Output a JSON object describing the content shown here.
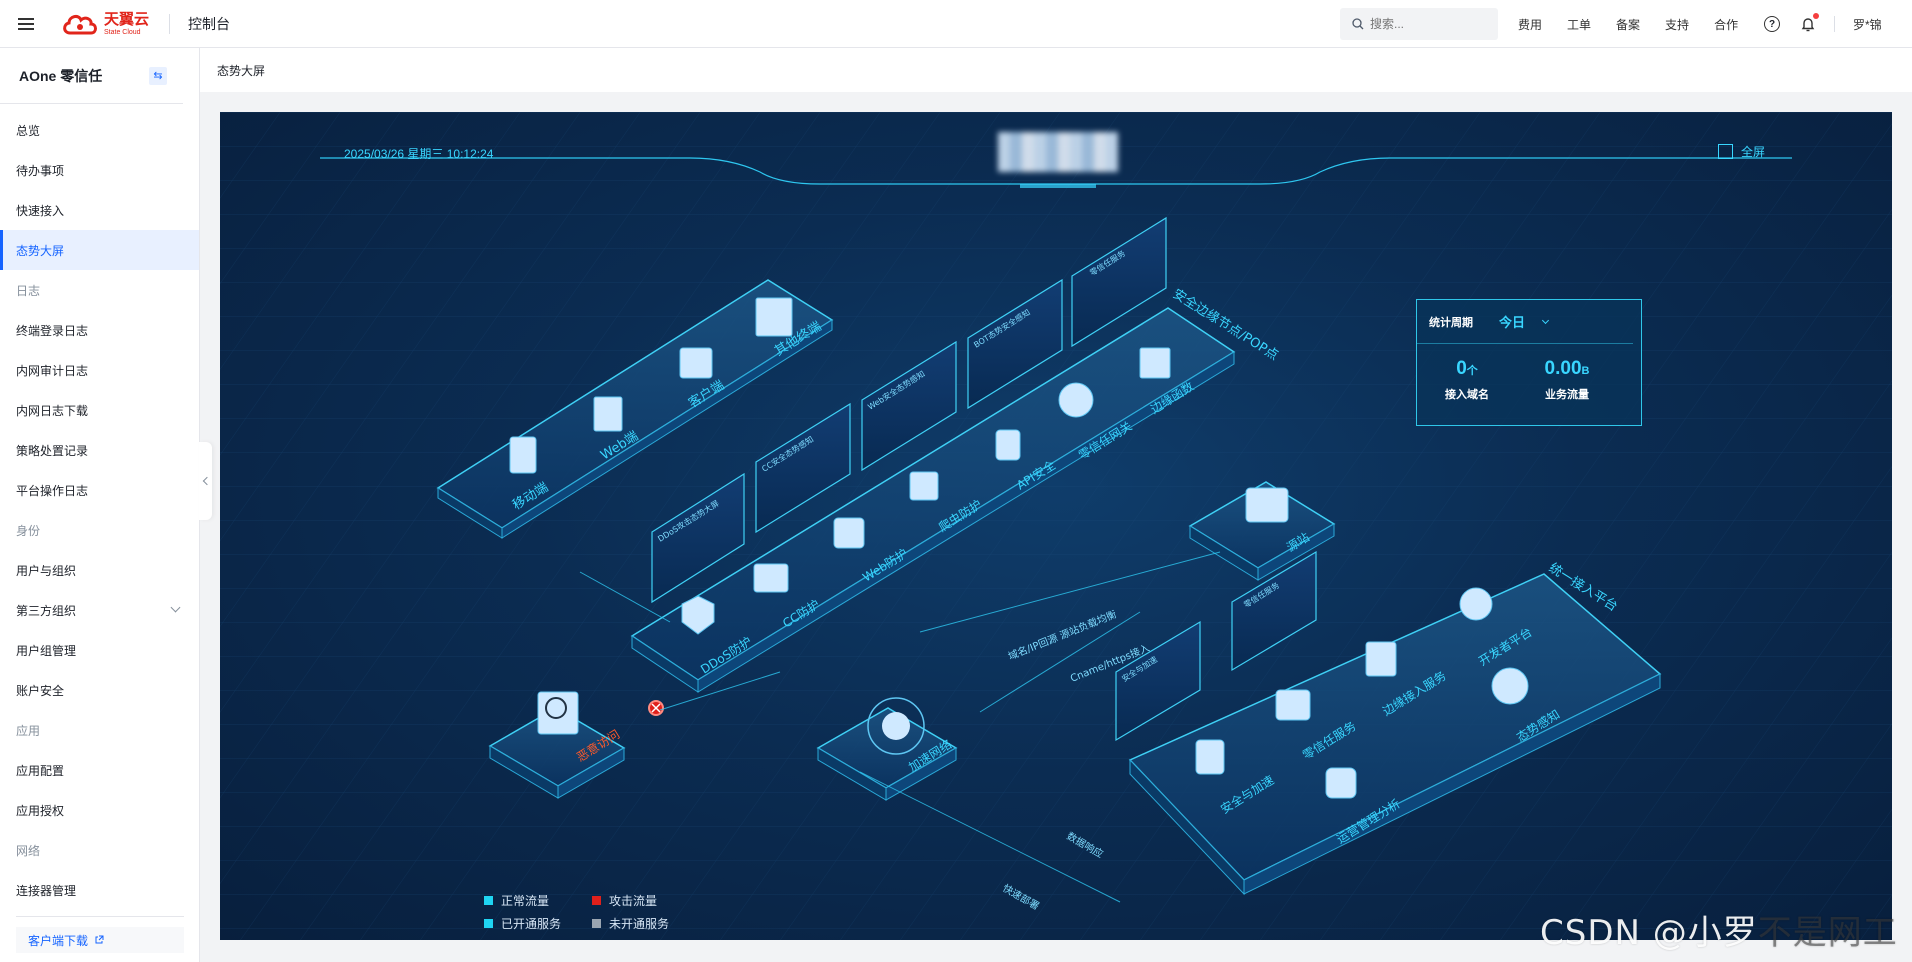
{
  "topbar": {
    "logo_cn": "天翼云",
    "logo_en": "State Cloud",
    "console": "控制台",
    "search_placeholder": "搜索...",
    "links": [
      "费用",
      "工单",
      "备案",
      "支持",
      "合作"
    ],
    "help_glyph": "?",
    "user": "罗*锦"
  },
  "sidebar": {
    "title": "AOne 零信任",
    "switch_glyph": "⇆",
    "items": [
      {
        "label": "总览",
        "type": "item"
      },
      {
        "label": "待办事项",
        "type": "item"
      },
      {
        "label": "快速接入",
        "type": "item"
      },
      {
        "label": "态势大屏",
        "type": "active"
      },
      {
        "label": "日志",
        "type": "group"
      },
      {
        "label": "终端登录日志",
        "type": "item"
      },
      {
        "label": "内网审计日志",
        "type": "item"
      },
      {
        "label": "内网日志下载",
        "type": "item"
      },
      {
        "label": "策略处置记录",
        "type": "item"
      },
      {
        "label": "平台操作日志",
        "type": "item"
      },
      {
        "label": "身份",
        "type": "group"
      },
      {
        "label": "用户与组织",
        "type": "item"
      },
      {
        "label": "第三方组织",
        "type": "expandable"
      },
      {
        "label": "用户组管理",
        "type": "item"
      },
      {
        "label": "账户安全",
        "type": "item"
      },
      {
        "label": "应用",
        "type": "group"
      },
      {
        "label": "应用配置",
        "type": "item"
      },
      {
        "label": "应用授权",
        "type": "item"
      },
      {
        "label": "网络",
        "type": "group"
      },
      {
        "label": "连接器管理",
        "type": "item"
      }
    ],
    "download": "客户端下载"
  },
  "breadcrumb": "态势大屏",
  "screen": {
    "datetime": "2025/03/26 星期三 10:12:24",
    "fullscreen": "全屏",
    "stats": {
      "period_label": "统计周期",
      "period_value": "今日",
      "domains_value": "0",
      "domains_unit": "个",
      "domains_label": "接入域名",
      "traffic_value": "0.00",
      "traffic_unit": "B",
      "traffic_label": "业务流量"
    },
    "platforms": {
      "clients": [
        "移动端",
        "Web端",
        "客户端",
        "其他终端"
      ],
      "pop_title": "安全边缘节点/POP点",
      "pop_services": [
        "DDoS防护",
        "CC防护",
        "Web防护",
        "爬虫防护",
        "API安全",
        "零信任网关",
        "边缘函数"
      ],
      "source": "源站",
      "attack": "恶意访问",
      "accel": "加速网络",
      "unified_title": "统一接入平台",
      "unified_services": [
        "安全与加速",
        "零信任服务",
        "边缘接入服务",
        "开发者平台",
        "运营管理分析",
        "态势感知"
      ],
      "flow_labels": [
        "域名/IP回源 源站负载均衡",
        "Cname/https接入",
        "数据响应",
        "快速部署"
      ],
      "panel_titles": [
        "DDoS攻击态势大屏",
        "CC安全态势感知",
        "Web安全态势感知",
        "BOT态势安全感知",
        "零信任服务",
        "安全与加速",
        "零信任服务"
      ]
    },
    "legend": [
      {
        "label": "正常流量",
        "color": "#1fd5f2"
      },
      {
        "label": "攻击流量",
        "color": "#e0201b"
      },
      {
        "label": "已开通服务",
        "color": "#1fd5f2"
      },
      {
        "label": "未开通服务",
        "color": "#9aa5b1"
      }
    ]
  },
  "watermark": {
    "part1": "CSDN @小罗",
    "part2": "不是网工"
  },
  "colors": {
    "accent": "#1664ff",
    "screen_cyan": "#39d6ff",
    "brand_red": "#e1251b"
  }
}
